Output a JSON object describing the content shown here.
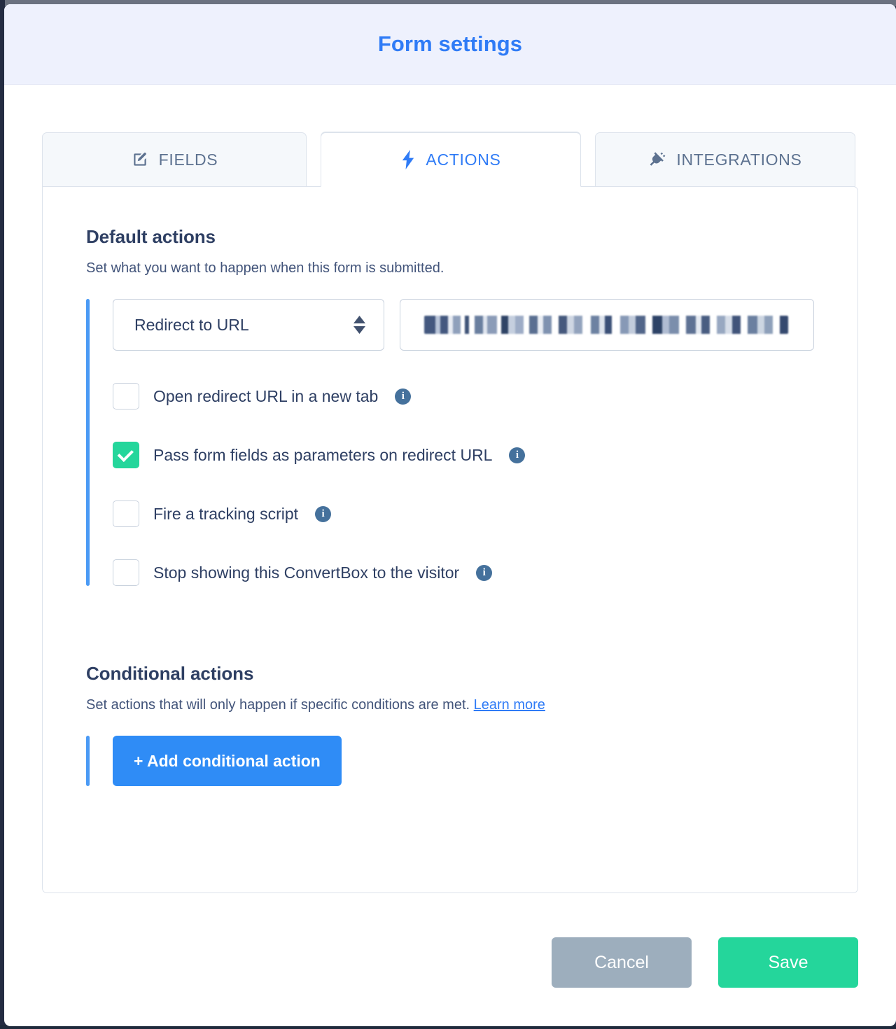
{
  "modal": {
    "title": "Form settings"
  },
  "tabs": [
    {
      "label": "FIELDS",
      "icon": "edit-square-icon",
      "active": false
    },
    {
      "label": "ACTIONS",
      "icon": "lightning-bolt-icon",
      "active": true
    },
    {
      "label": "INTEGRATIONS",
      "icon": "plug-icon",
      "active": false
    }
  ],
  "default_actions": {
    "heading": "Default actions",
    "description": "Set what you want to happen when this form is submitted.",
    "action_select": {
      "value": "Redirect to URL",
      "options": [
        "Redirect to URL"
      ]
    },
    "url_input": {
      "value": "",
      "placeholder": "",
      "redacted": true
    },
    "checkboxes": [
      {
        "label": "Open redirect URL in a new tab",
        "checked": false,
        "info": "i"
      },
      {
        "label": "Pass form fields as parameters on redirect URL",
        "checked": true,
        "info": "i"
      },
      {
        "label": "Fire a tracking script",
        "checked": false,
        "info": "i"
      },
      {
        "label": "Stop showing this ConvertBox to the visitor",
        "checked": false,
        "info": "i"
      }
    ]
  },
  "conditional_actions": {
    "heading": "Conditional actions",
    "description": "Set actions that will only happen if specific conditions are met.",
    "learn_more": "Learn more",
    "add_button": "+ Add conditional action"
  },
  "footer": {
    "cancel_label": "Cancel",
    "save_label": "Save"
  },
  "colors": {
    "header_bg": "#eef1fd",
    "title_blue": "#2f7bf6",
    "accent_rail": "#4a9af5",
    "checked_green": "#24d69b",
    "primary_blue": "#2f8cf6",
    "cancel_grey": "#9daebd",
    "text_dark": "#2e3f63"
  }
}
